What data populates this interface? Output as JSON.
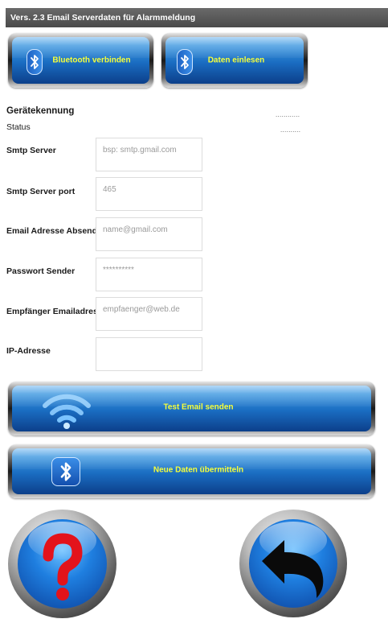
{
  "titlebar": {
    "text": "Vers. 2.3  Email  Serverdaten für Alarmmeldung"
  },
  "buttons": {
    "bluetooth_connect": "Bluetooth verbinden",
    "read_data": "Daten einlesen",
    "test_email": "Test Email senden",
    "send_new_data": "Neue Daten übermitteln"
  },
  "device": {
    "id_label": "Gerätekennung",
    "id_value": "............",
    "status_label": "Status",
    "status_value": ".........."
  },
  "form": {
    "smtp_server": {
      "label": "Smtp Server",
      "value": "",
      "placeholder": "bsp: smtp.gmail.com"
    },
    "smtp_port": {
      "label": "Smtp Server port",
      "value": "",
      "placeholder": "465"
    },
    "sender_email": {
      "label": "Email Adresse Absender",
      "value": "",
      "placeholder": "name@gmail.com"
    },
    "sender_password": {
      "label": "Passwort Sender",
      "value": "",
      "placeholder": "**********"
    },
    "recipient_email": {
      "label": "Empfänger Emailadresse",
      "value": "",
      "placeholder": "empfaenger@web.de"
    },
    "ip_address": {
      "label": "IP-Adresse",
      "value": "",
      "placeholder": ""
    }
  },
  "icons": {
    "bluetooth": "bluetooth-icon",
    "wifi": "wifi-icon",
    "help": "question-mark-icon",
    "back": "back-arrow-icon"
  },
  "colors": {
    "button_text": "#f7ff3a",
    "button_blue": "#1a6cc1",
    "help_mark": "#e3131b",
    "titlebar": "#5a5a5a"
  }
}
